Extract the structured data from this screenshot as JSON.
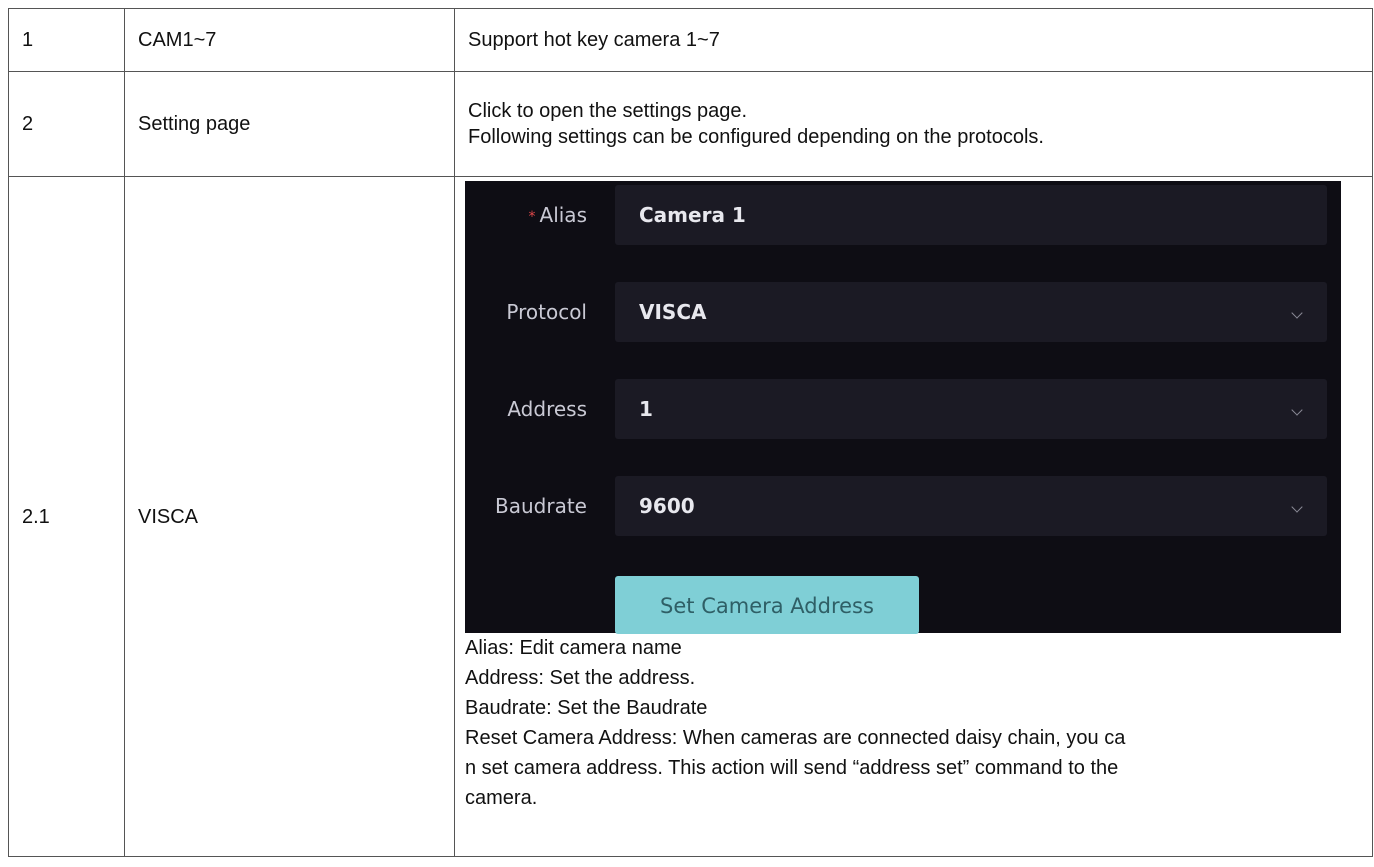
{
  "rows": [
    {
      "num": "1",
      "name": "CAM1~7",
      "desc": "Support hot key camera 1~7"
    },
    {
      "num": "2",
      "name": "Setting page",
      "desc_lines": [
        "Click to open the settings page.",
        "Following settings can be configured depending on the protocols."
      ]
    },
    {
      "num": "2.1",
      "name": "VISCA"
    }
  ],
  "settings_panel": {
    "alias_label": "Alias",
    "alias_required_mark": "*",
    "alias_value": "Camera 1",
    "protocol_label": "Protocol",
    "protocol_value": "VISCA",
    "address_label": "Address",
    "address_value": "1",
    "baudrate_label": "Baudrate",
    "baudrate_value": "9600",
    "set_button_label": "Set Camera Address"
  },
  "notes": [
    "Alias: Edit camera name",
    "Address: Set the address.",
    "Baudrate: Set the Baudrate",
    "Reset Camera Address: When cameras are connected daisy chain, you ca",
    "n set camera address. This action will send “address set” command to the",
    "camera."
  ],
  "colors": {
    "panel_bg": "#0e0d14",
    "field_bg": "#1b1a24",
    "button_bg": "#7fcfd6",
    "required_mark": "#e0484a"
  },
  "icons": {
    "dropdown": "chevron-down-icon"
  }
}
